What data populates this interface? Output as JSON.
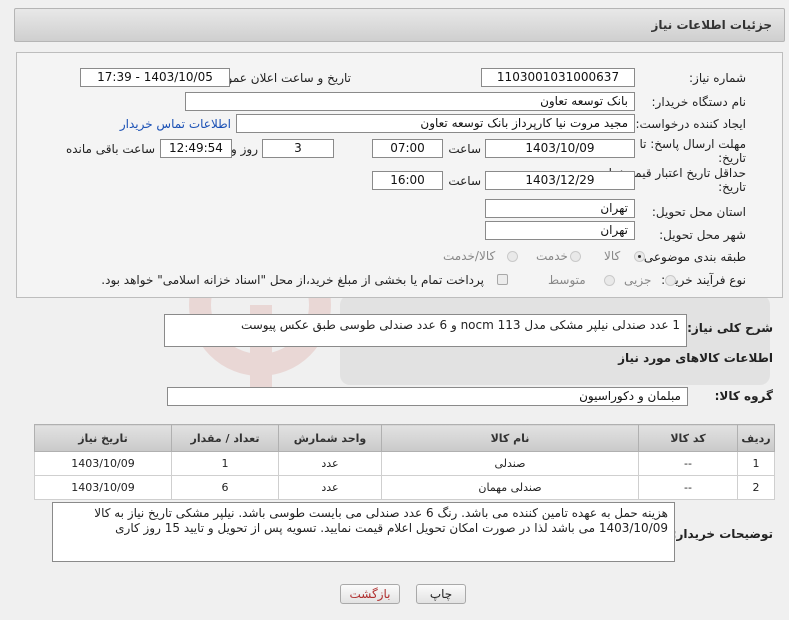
{
  "header": {
    "title": "جزئیات اطلاعات نیاز"
  },
  "form": {
    "need_number": {
      "label": "شماره نیاز:",
      "value": "1103001031000637"
    },
    "announce": {
      "label": "تاریخ و ساعت اعلان عمومی:",
      "value": "1403/10/05 - 17:39"
    },
    "buyer_org": {
      "label": "نام دستگاه خریدار:",
      "value": "بانک توسعه تعاون"
    },
    "requester": {
      "label": "ایجاد کننده درخواست:",
      "value": "مجید مروت نیا کارپرداز بانک توسعه تعاون",
      "contact_link": "اطلاعات تماس خریدار"
    },
    "reply_deadline": {
      "label_line1": "مهلت ارسال پاسخ: تا",
      "label_line2": "تاریخ:",
      "date": "1403/10/09",
      "time_label": "ساعت",
      "time": "07:00",
      "days": "3",
      "days_label": "روز و",
      "remaining": "12:49:54",
      "remaining_label": "ساعت باقی مانده"
    },
    "price_validity": {
      "label_line1": "حداقل تاریخ اعتبار قیمت: تا",
      "label_line2": "تاریخ:",
      "date": "1403/12/29",
      "time_label": "ساعت",
      "time": "16:00"
    },
    "province": {
      "label": "استان محل تحویل:",
      "value": "تهران"
    },
    "city": {
      "label": "شهر محل تحویل:",
      "value": "تهران"
    },
    "category": {
      "label": "طبقه بندی موضوعی:",
      "options": [
        "کالا",
        "خدمت",
        "کالا/خدمت"
      ],
      "selected": "کالا"
    },
    "purchase_type": {
      "label": "نوع فرآیند خرید :",
      "options": [
        "جزیی",
        "متوسط"
      ],
      "note": "پرداخت تمام یا بخشی از مبلغ خرید،از محل \"اسناد خزانه اسلامی\" خواهد بود."
    }
  },
  "summary": {
    "label": "شرح کلی نیاز:",
    "value": "1 عدد صندلی نیلپر مشکی مدل nocm 113 و 6 عدد صندلی طوسی طبق عکس پیوست"
  },
  "goods": {
    "section_title": "اطلاعات کالاهای مورد نیاز",
    "group_label": "گروه کالا:",
    "group_value": "مبلمان و دکوراسیون",
    "columns": [
      "ردیف",
      "کد کالا",
      "نام کالا",
      "واحد شمارش",
      "تعداد / مقدار",
      "تاریخ نیاز"
    ],
    "rows": [
      [
        "1",
        "--",
        "صندلی",
        "عدد",
        "1",
        "1403/10/09"
      ],
      [
        "2",
        "--",
        "صندلی مهمان",
        "عدد",
        "6",
        "1403/10/09"
      ]
    ]
  },
  "buyer_notes": {
    "label": "توضیحات خریدار:",
    "value": "هزینه حمل به عهده تامین کننده می باشد. رنگ 6 عدد صندلی می بایست طوسی باشد. نیلپر مشکی تاریخ نیاز به کالا 1403/10/09 می باشد لذا در صورت امکان تحویل اعلام قیمت نمایید. تسویه پس از تحویل و تایید 15 روز کاری"
  },
  "buttons": {
    "print": "چاپ",
    "back": "بازگشت"
  },
  "colors": {
    "link": "#1a50b5",
    "back_button_text": "#b03030"
  }
}
